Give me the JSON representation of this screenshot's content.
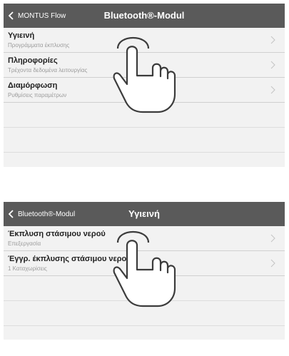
{
  "screen1": {
    "back_label": "MONTUS Flow",
    "title": "Bluetooth®-Modul",
    "items": [
      {
        "title": "Υγιεινή",
        "subtitle": "Προγράμματα έκπλυσης"
      },
      {
        "title": "Πληροφορίες",
        "subtitle": "Τρέχοντα δεδομένα λειτουργίας"
      },
      {
        "title": "Διαμόρφωση",
        "subtitle": "Ρυθμίσεις παραμέτρων"
      }
    ]
  },
  "screen2": {
    "back_label": "Bluetooth®-Modul",
    "title": "Υγιεινή",
    "items": [
      {
        "title": "Έκπλυση στάσιμου νερού",
        "subtitle": "Επεξεργασία"
      },
      {
        "title": "Έγγρ. έκπλυσης στάσιμου νερού",
        "subtitle": "1 Καταχωρίσεις"
      }
    ]
  },
  "colors": {
    "header": "#5a5a5a",
    "background": "#f2f2f2",
    "divider": "#d0d0d0",
    "subtitle": "#9b9b9b"
  },
  "icons": {
    "back": "chevron-left-icon",
    "row_arrow": "chevron-right-icon",
    "gesture": "tap-hand-icon"
  }
}
